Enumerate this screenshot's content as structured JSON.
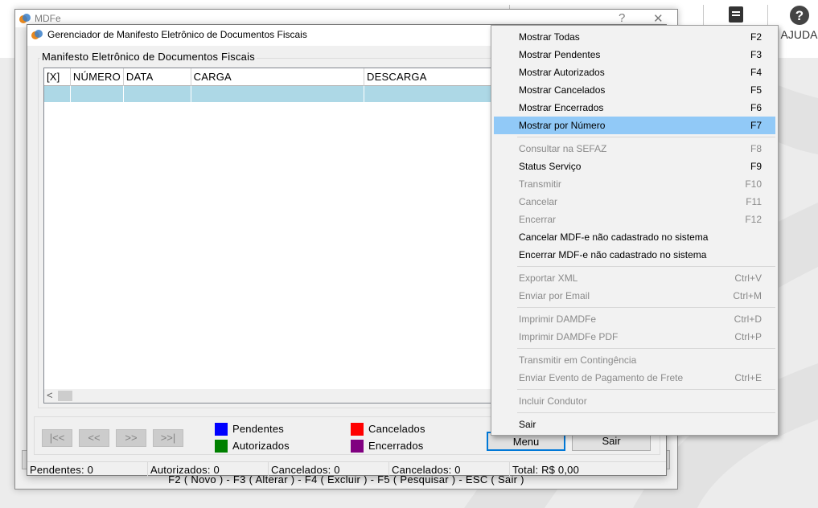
{
  "background": {
    "help_label": "AJUDA"
  },
  "outer_window": {
    "title": "MDFe",
    "help_control": "?",
    "close_control": "✕",
    "function_keys": "F2 ( Novo )  -  F3 ( Alterar )  -  F4 ( Excluir )  -  F5 ( Pesquisar )  -  ESC ( Sair )"
  },
  "dialog": {
    "title": "Gerenciador de Manifesto Eletrônico de Documentos Fiscais",
    "group_caption": "Manifesto Eletrônico de Documentos Fiscais",
    "columns": [
      "[X]",
      "NÚMERO",
      "DATA",
      "CARGA",
      "DESCARGA"
    ],
    "rows": [
      [
        "",
        "",
        "",
        "",
        ""
      ]
    ],
    "scroll_left": "<",
    "nav": {
      "first": "|<<",
      "prev": "<<",
      "next": ">>",
      "last": ">>|"
    },
    "legend": [
      {
        "label": "Pendentes",
        "color": "#0000ff"
      },
      {
        "label": "Autorizados",
        "color": "#008000"
      },
      {
        "label": "Cancelados",
        "color": "#ff0000"
      },
      {
        "label": "Encerrados",
        "color": "#800080"
      }
    ],
    "buttons": {
      "menu": "Menu",
      "sair": "Sair"
    },
    "status": [
      "Pendentes: 0",
      "Autorizados: 0",
      "Cancelados: 0",
      "Cancelados: 0",
      "Total: R$ 0,00"
    ]
  },
  "context_menu": {
    "groups": [
      [
        {
          "label": "Mostrar Todas",
          "shortcut": "F2",
          "enabled": true
        },
        {
          "label": "Mostrar Pendentes",
          "shortcut": "F3",
          "enabled": true
        },
        {
          "label": "Mostrar Autorizados",
          "shortcut": "F4",
          "enabled": true
        },
        {
          "label": "Mostrar Cancelados",
          "shortcut": "F5",
          "enabled": true
        },
        {
          "label": "Mostrar Encerrados",
          "shortcut": "F6",
          "enabled": true
        },
        {
          "label": "Mostrar por Número",
          "shortcut": "F7",
          "enabled": true,
          "highlighted": true
        }
      ],
      [
        {
          "label": "Consultar na SEFAZ",
          "shortcut": "F8",
          "enabled": false
        },
        {
          "label": "Status Serviço",
          "shortcut": "F9",
          "enabled": true
        },
        {
          "label": "Transmitir",
          "shortcut": "F10",
          "enabled": false
        },
        {
          "label": "Cancelar",
          "shortcut": "F11",
          "enabled": false
        },
        {
          "label": "Encerrar",
          "shortcut": "F12",
          "enabled": false
        },
        {
          "label": "Cancelar MDF-e não cadastrado no sistema",
          "shortcut": "",
          "enabled": true
        },
        {
          "label": "Encerrar MDF-e não cadastrado no sistema",
          "shortcut": "",
          "enabled": true
        }
      ],
      [
        {
          "label": "Exportar XML",
          "shortcut": "Ctrl+V",
          "enabled": false
        },
        {
          "label": "Enviar por Email",
          "shortcut": "Ctrl+M",
          "enabled": false
        }
      ],
      [
        {
          "label": "Imprimir DAMDFe",
          "shortcut": "Ctrl+D",
          "enabled": false
        },
        {
          "label": "Imprimir DAMDFe PDF",
          "shortcut": "Ctrl+P",
          "enabled": false
        }
      ],
      [
        {
          "label": "Transmitir em Contingência",
          "shortcut": "",
          "enabled": false
        },
        {
          "label": "Enviar Evento de Pagamento de Frete",
          "shortcut": "Ctrl+E",
          "enabled": false
        }
      ],
      [
        {
          "label": "Incluir Condutor",
          "shortcut": "",
          "enabled": false
        }
      ],
      [
        {
          "label": "Sair",
          "shortcut": "",
          "enabled": true
        }
      ]
    ]
  }
}
